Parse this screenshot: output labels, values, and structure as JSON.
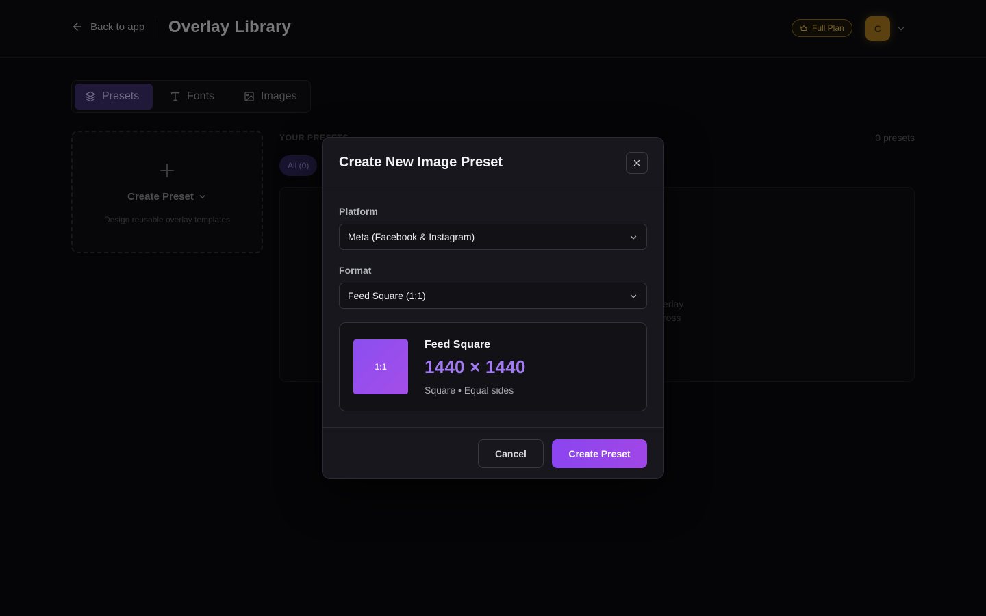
{
  "header": {
    "back_label": "Back to app",
    "title": "Overlay Library",
    "plan_badge": "Full Plan",
    "avatar_initial": "C"
  },
  "tabs": [
    {
      "label": "Presets",
      "icon": "layers-icon",
      "active": true
    },
    {
      "label": "Fonts",
      "icon": "type-icon",
      "active": false
    },
    {
      "label": "Images",
      "icon": "image-icon",
      "active": false
    }
  ],
  "create_card": {
    "label": "Create Preset",
    "subtitle": "Design reusable overlay templates"
  },
  "presets_section": {
    "heading": "YOUR PRESETS",
    "count": "0 presets",
    "filter_all": "All (0)",
    "empty_text_line1": "erlay",
    "empty_text_line2": "ross"
  },
  "modal": {
    "title": "Create New Image Preset",
    "platform_label": "Platform",
    "platform_value": "Meta (Facebook & Instagram)",
    "format_label": "Format",
    "format_value": "Feed Square (1:1)",
    "preview": {
      "ratio": "1:1",
      "name": "Feed Square",
      "dimensions": "1440 × 1440",
      "description": "Square • Equal sides"
    },
    "cancel_label": "Cancel",
    "create_label": "Create Preset"
  },
  "colors": {
    "accent": "#8b45f0",
    "dimension_text": "#a27bf2",
    "plan_gold": "#e0b347",
    "avatar": "#a6771d",
    "background": "#0a0a0d"
  }
}
